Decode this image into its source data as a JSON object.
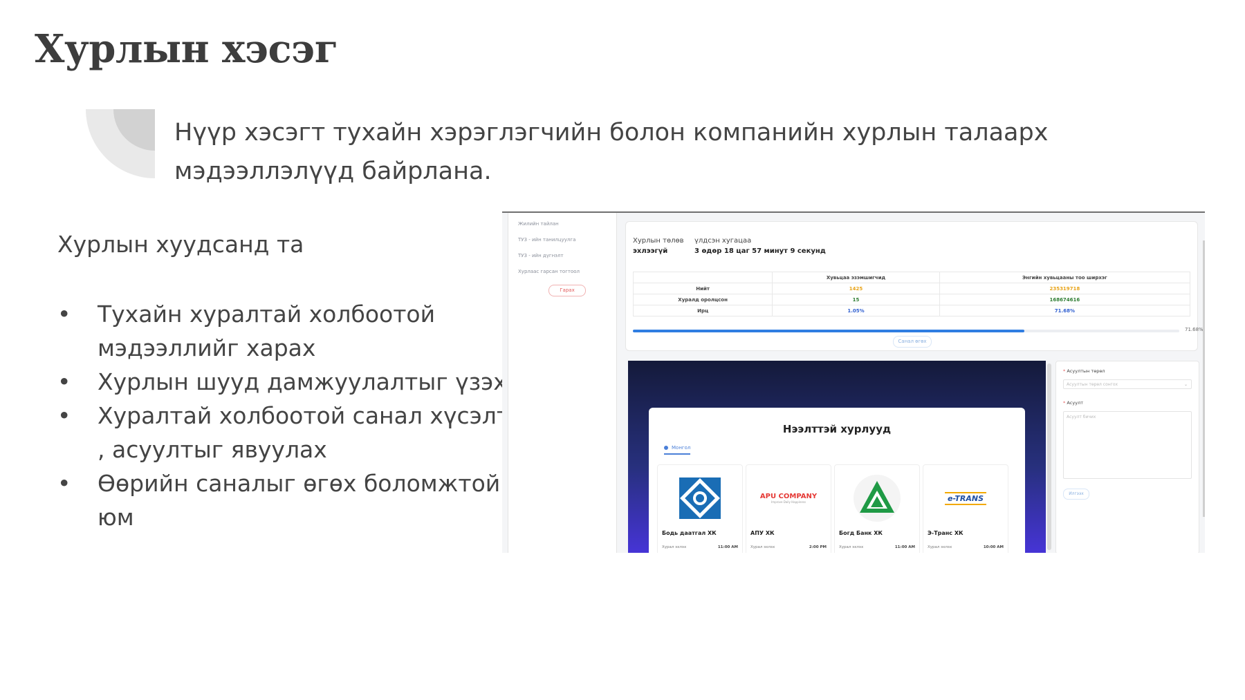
{
  "slide": {
    "title": "Хурлын хэсэг",
    "subtitle": "Нүүр хэсэгт тухайн хэрэглэгчийн болон компанийн хурлын талаарх мэдээллэлүүд байрлана.",
    "lead": "Хурлын хуудсанд та",
    "bullets": [
      "Тухайн хуралтай холбоотой мэдээллийг харах",
      "Хурлын шууд дамжуулалтыг үзэх",
      "Хуралтай холбоотой санал хүсэлт , асуултыг явуулах",
      "Өөрийн саналыг өгөх боломжтой юм"
    ]
  },
  "screenshot": {
    "sidebar": {
      "items": [
        "Жилийн тайлан",
        "ТУЗ - ийн танилцуулга",
        "ТУЗ - ийн дүгнэлт",
        "Хурлаас гарсан тогтоол"
      ],
      "exit_button": "Гарах"
    },
    "status": {
      "label": "Хурлын төлөв",
      "value": "эхлээгүй",
      "remaining_label": "үлдсэн хугацаа",
      "remaining_value": "3 өдөр 18 цаг 57 минут 9 секунд"
    },
    "stats_table": {
      "headers": [
        "",
        "Хувьцаа эзэмшигчид",
        "Энгийн хувьцааны тоо ширхэг"
      ],
      "rows": [
        {
          "label": "Нийт",
          "a": "1425",
          "b": "235319718"
        },
        {
          "label": "Хуралд оролцсон",
          "a": "15",
          "b": "168674616"
        },
        {
          "label": "Ирц",
          "a": "1.05%",
          "b": "71.68%"
        }
      ]
    },
    "progress": {
      "value": 71.68,
      "label": "71.68%"
    },
    "vote_button": "Санал өгөх",
    "meetings": {
      "title": "Нээлттэй хурлууд",
      "tab": "Монгол",
      "companies": [
        {
          "name": "Бодь даатгал ХК",
          "meta": "Хурал эхлэх",
          "time": "11:00 AM"
        },
        {
          "name": "АПУ ХК",
          "meta": "Хурал эхлэх",
          "time": "2:00 PM",
          "logo_text": "APU COMPANY",
          "logo_sub": "Improve Daily Happiness"
        },
        {
          "name": "Богд Банк ХК",
          "meta": "Хурал эхлэх",
          "time": "11:00 AM"
        },
        {
          "name": "Э-Транс ХК",
          "meta": "Хурал эхлэх",
          "time": "10:00 AM",
          "logo_text": "e-TRANS"
        }
      ]
    },
    "question_form": {
      "type_label": "Асуултын төрөл",
      "type_placeholder": "Асуултын төрөл сонгох",
      "question_label": "Асуулт",
      "question_placeholder": "Асуулт бичих",
      "send_button": "Илгээх"
    },
    "colors": {
      "accent": "#2f7de1",
      "total_orange": "#e8a317",
      "participated_green": "#2e7d32",
      "attendance_blue": "#2f5fd0"
    }
  }
}
